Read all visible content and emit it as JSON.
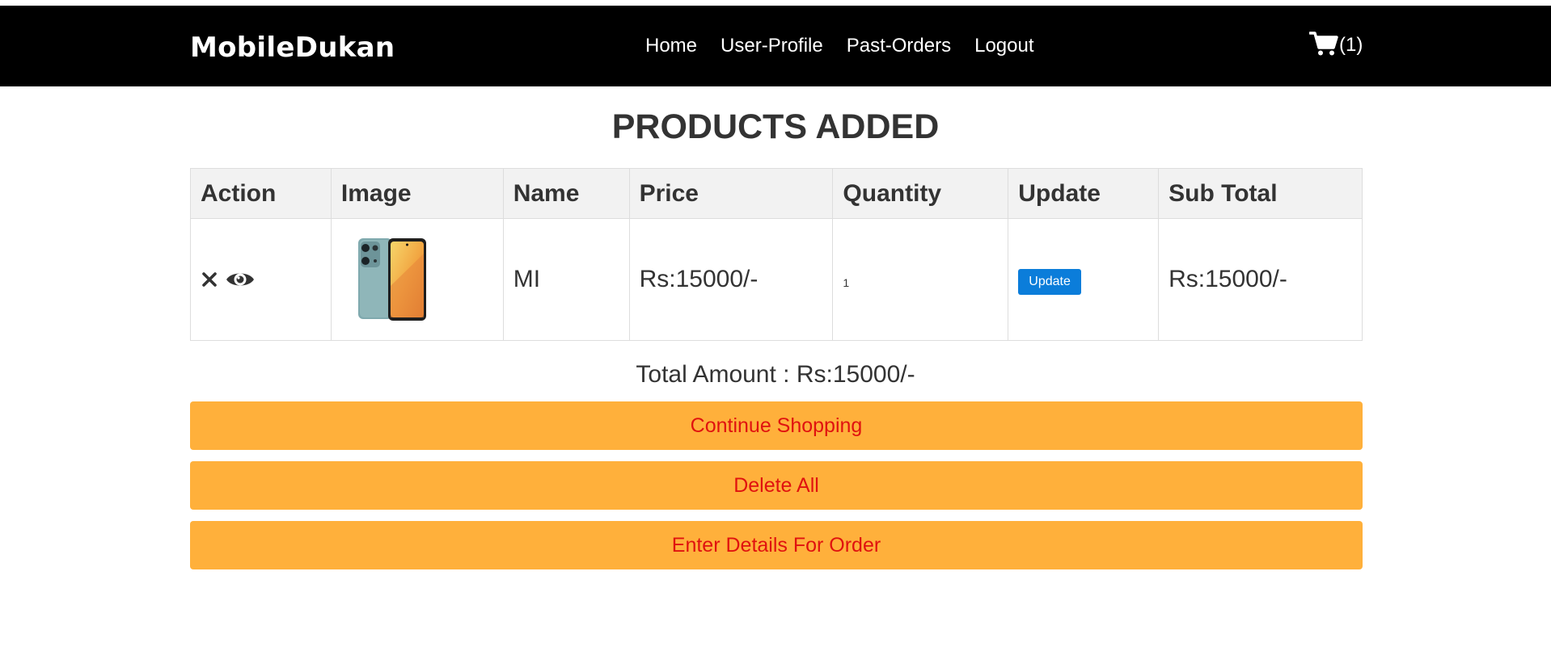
{
  "header": {
    "brand": "MobileDukan",
    "nav": [
      {
        "label": "Home"
      },
      {
        "label": "User-Profile"
      },
      {
        "label": "Past-Orders"
      },
      {
        "label": "Logout"
      }
    ],
    "cart_icon": "shopping-cart-icon",
    "cart_count": "(1)"
  },
  "main": {
    "title": "PRODUCTS ADDED",
    "table": {
      "columns": [
        "Action",
        "Image",
        "Name",
        "Price",
        "Quantity",
        "Update",
        "Sub Total"
      ],
      "rows": [
        {
          "action_icons": [
            "remove-icon",
            "view-icon"
          ],
          "image": "mobile-phone-image",
          "name": "MI",
          "price": "Rs:15000/-",
          "quantity": "1",
          "update_label": "Update",
          "sub_total": "Rs:15000/-"
        }
      ]
    },
    "total": "Total Amount : Rs:15000/-",
    "buttons": {
      "continue": "Continue Shopping",
      "delete_all": "Delete All",
      "order": "Enter Details For Order"
    }
  },
  "colors": {
    "navbar_bg": "#000000",
    "table_header_bg": "#f2f2f2",
    "button_bg": "#ffb03b",
    "button_text": "#e0120f",
    "update_button_bg": "#0b7dda"
  }
}
